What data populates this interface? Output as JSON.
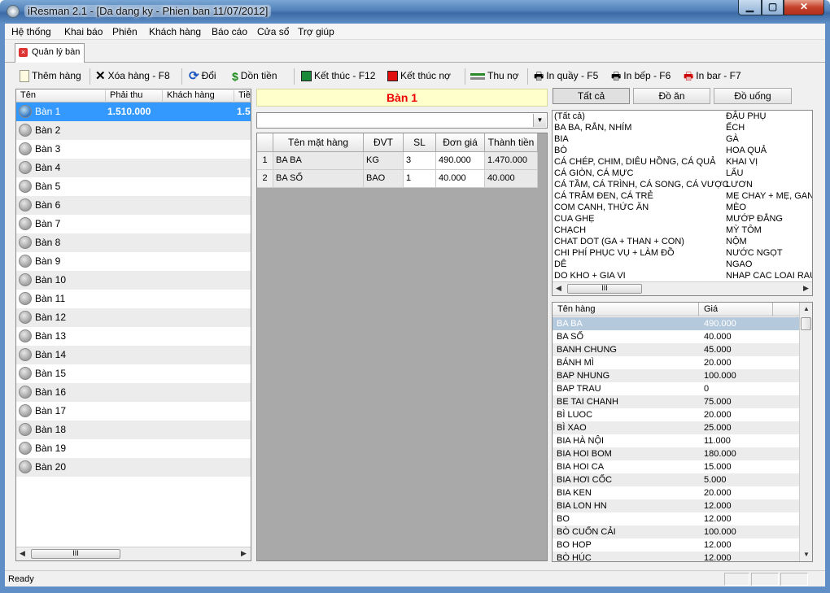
{
  "window": {
    "title": "iResman 2.1 - [Da dang ky - Phien ban 11/07/2012]",
    "min": "▁",
    "max": "▢",
    "close": "✕"
  },
  "menu": [
    "Hệ thống",
    "Khai báo",
    "Phiên",
    "Khách hàng",
    "Báo cáo",
    "Cửa sổ",
    "Trợ giúp"
  ],
  "doc_tab": {
    "label": "Quản lý bàn",
    "close_icon": "×"
  },
  "toolbar": {
    "add": "Thêm hàng",
    "delete": "Xóa hàng - F8",
    "swap": "Đổi",
    "merge": "Dồn tiền",
    "finish": "Kết thúc - F12",
    "finish_debt": "Kết thúc nợ",
    "collect": "Thu nợ",
    "print_counter": "In quầy - F5",
    "print_kitchen": "In bếp - F6",
    "print_bar": "In bar - F7"
  },
  "tables_panel": {
    "headers": [
      "Tên",
      "Phải thu",
      "Khách hàng",
      "Tiề"
    ],
    "rows": [
      {
        "name": "Bàn  1",
        "pay": "1.510.000",
        "cut": "1.5"
      },
      {
        "name": "Bàn  2"
      },
      {
        "name": "Bàn  3"
      },
      {
        "name": "Bàn  4"
      },
      {
        "name": "Bàn  5"
      },
      {
        "name": "Bàn  6"
      },
      {
        "name": "Bàn  7"
      },
      {
        "name": "Bàn  8"
      },
      {
        "name": "Bàn  9"
      },
      {
        "name": "Bàn  10"
      },
      {
        "name": "Bàn  11"
      },
      {
        "name": "Bàn  12"
      },
      {
        "name": "Bàn  13"
      },
      {
        "name": "Bàn  14"
      },
      {
        "name": "Bàn  15"
      },
      {
        "name": "Bàn  16"
      },
      {
        "name": "Bàn  17"
      },
      {
        "name": "Bàn  18"
      },
      {
        "name": "Bàn  19"
      },
      {
        "name": "Bàn  20"
      }
    ],
    "scroll_thumb": "III"
  },
  "order": {
    "banner": "Bàn  1",
    "combo_arrow": "▼",
    "headers": [
      "",
      "Tên mặt hàng",
      "ĐVT",
      "SL",
      "Đơn giá",
      "Thành tiền"
    ],
    "rows": [
      [
        "1",
        "BA BA",
        "KG",
        "3",
        "490.000",
        "1.470.000"
      ],
      [
        "2",
        "BA SỐ",
        "BAO",
        "1",
        "40.000",
        "40.000"
      ]
    ]
  },
  "category_tabs": [
    "Tất cả",
    "Đồ ăn",
    "Đồ uống"
  ],
  "categories_col1": [
    "(Tất cả)",
    "BA BA, RẮN, NHÍM",
    "BIA",
    "BÒ",
    "CÁ CHÉP, CHIM, DIÊU HỒNG, CÁ QUẢ",
    "CÁ GIÒN, CÁ MỰC",
    "CÁ TẦM, CÁ TRÌNH, CÁ SONG, CÁ VƯỢC",
    "CÁ TRẮM ĐEN, CÁ TRẺ",
    "COM CANH, THỨC ĂN",
    "CUA GHẸ",
    "CHẠCH",
    "CHAT DOT (GA + THAN + CON)",
    "CHI PHÍ PHỤC VỤ + LÀM ĐỒ",
    "DÊ",
    "DO KHO + GIA VI"
  ],
  "categories_col2": [
    "ĐẬU PHỤ",
    "ẾCH",
    "GÀ",
    "HOA QUẢ",
    "KHAI VỊ",
    "LẨU",
    "LƯƠN",
    "MẸ CHAY + MẸ, GAN G",
    "MÈO",
    "MƯỚP ĐẮNG",
    "MỲ TÔM",
    "NỘM",
    "NƯỚC NGỌT",
    "NGAO",
    "NHAP CAC LOAI RAU"
  ],
  "products": {
    "headers": [
      "Tên hàng",
      "Giá"
    ],
    "rows": [
      [
        "BA BA",
        "490.000"
      ],
      [
        "BA SỐ",
        "40.000"
      ],
      [
        "BANH CHUNG",
        "45.000"
      ],
      [
        "BÁNH MÌ",
        "20.000"
      ],
      [
        "BAP NHUNG",
        "100.000"
      ],
      [
        "BAP TRAU",
        "0"
      ],
      [
        "BE TAI CHANH",
        "75.000"
      ],
      [
        "BÌ LUOC",
        "20.000"
      ],
      [
        "BÌ XAO",
        "25.000"
      ],
      [
        "BIA HÀ NỘI",
        "11.000"
      ],
      [
        "BIA HOI BOM",
        "180.000"
      ],
      [
        "BIA HOI CA",
        "15.000"
      ],
      [
        "BIA HƠI CỐC",
        "5.000"
      ],
      [
        "BIA KEN",
        "20.000"
      ],
      [
        "BIA LON HN",
        "12.000"
      ],
      [
        "BO",
        "12.000"
      ],
      [
        "BÒ CUỐN CẢI",
        "100.000"
      ],
      [
        "BO HOP",
        "12.000"
      ],
      [
        "BÒ HÚC",
        "12.000"
      ]
    ]
  },
  "status": {
    "text": "Ready"
  }
}
